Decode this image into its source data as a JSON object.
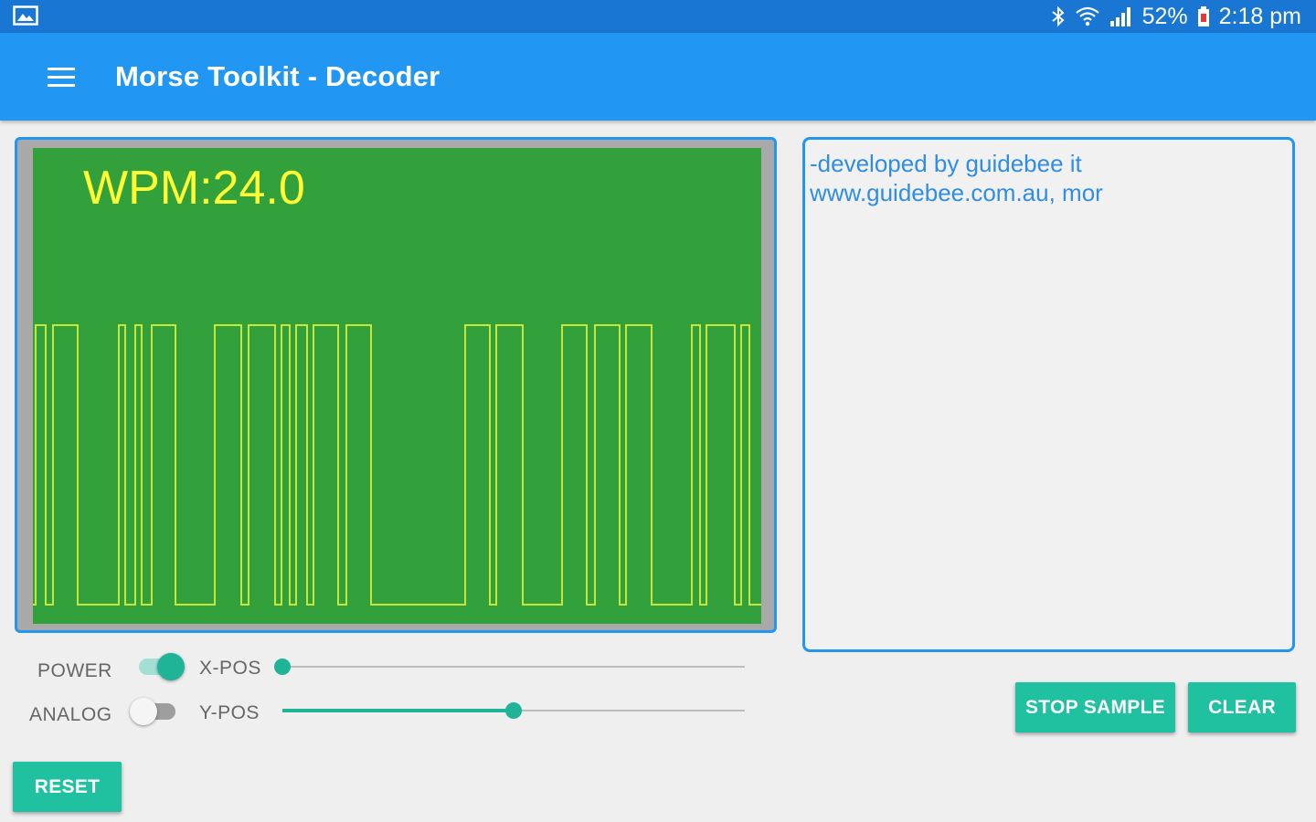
{
  "status_bar": {
    "battery": "52%",
    "time": "2:18 pm",
    "icons": [
      "gallery-icon",
      "bluetooth-icon",
      "wifi-icon",
      "signal-icon",
      "battery-icon"
    ]
  },
  "app_bar": {
    "title": "Morse Toolkit - Decoder",
    "menu_icon": "hamburger-menu-icon"
  },
  "scope": {
    "wpm_label": "WPM:24.0",
    "colors": {
      "screen": "#33a13b",
      "trace": "#c8e63a",
      "label": "#ffff33"
    }
  },
  "decoded_text": "-developed by guidebee it\nwww.guidebee.com.au, mor",
  "controls": {
    "power": {
      "label": "POWER",
      "on": true
    },
    "analog": {
      "label": "ANALOG",
      "on": false
    },
    "x_pos": {
      "label": "X-POS",
      "value": 0.0
    },
    "y_pos": {
      "label": "Y-POS",
      "value": 0.5
    }
  },
  "buttons": {
    "stop_sample": "STOP SAMPLE",
    "clear": "CLEAR",
    "reset": "RESET"
  },
  "colors": {
    "accent": "#1fc1a0",
    "primary": "#2196f3",
    "primary_dark": "#1976d2"
  }
}
